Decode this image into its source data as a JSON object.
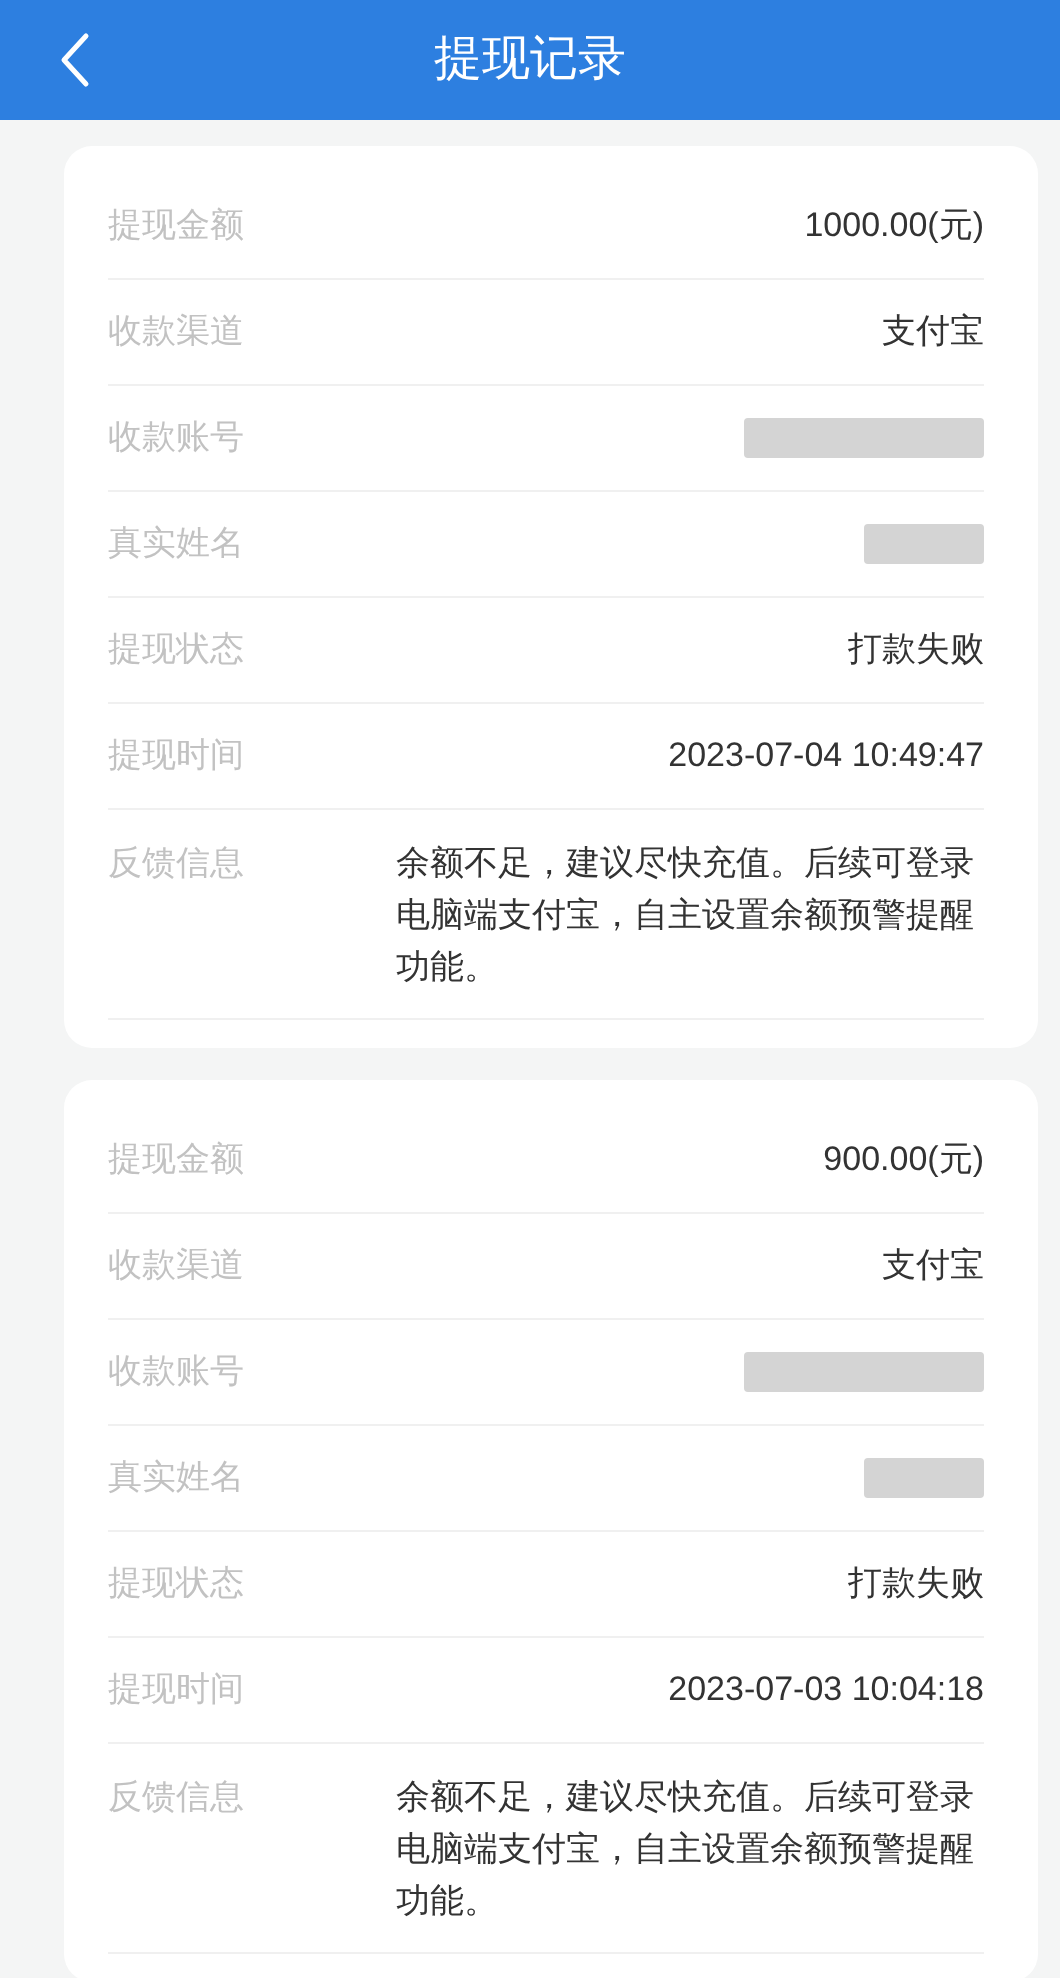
{
  "header": {
    "title": "提现记录"
  },
  "records": [
    {
      "rows": [
        {
          "kind": "text",
          "label": "提现金额",
          "value": "1000.00(元)"
        },
        {
          "kind": "text",
          "label": "收款渠道",
          "value": "支付宝"
        },
        {
          "kind": "redacted",
          "label": "收款账号"
        },
        {
          "kind": "redacted",
          "label": "真实姓名"
        },
        {
          "kind": "text",
          "label": "提现状态",
          "value": "打款失败"
        },
        {
          "kind": "text",
          "label": "提现时间",
          "value": "2023-07-04 10:49:47"
        },
        {
          "kind": "multiline",
          "label": "反馈信息",
          "value": "余额不足，建议尽快充值。后续可登录电脑端支付宝，自主设置余额预警提醒功能。"
        }
      ]
    },
    {
      "rows": [
        {
          "kind": "text",
          "label": "提现金额",
          "value": "900.00(元)"
        },
        {
          "kind": "text",
          "label": "收款渠道",
          "value": "支付宝"
        },
        {
          "kind": "redacted",
          "label": "收款账号"
        },
        {
          "kind": "redacted",
          "label": "真实姓名"
        },
        {
          "kind": "text",
          "label": "提现状态",
          "value": "打款失败"
        },
        {
          "kind": "text",
          "label": "提现时间",
          "value": "2023-07-03 10:04:18"
        },
        {
          "kind": "multiline",
          "label": "反馈信息",
          "value": "余额不足，建议尽快充值。后续可登录电脑端支付宝，自主设置余额预警提醒功能。"
        }
      ]
    }
  ]
}
